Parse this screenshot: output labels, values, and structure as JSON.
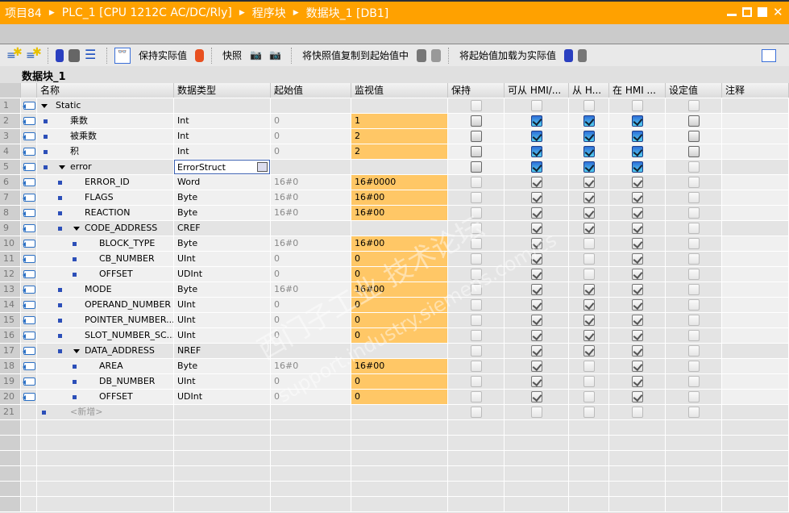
{
  "breadcrumb": [
    "项目84",
    "PLC_1 [CPU 1212C AC/DC/Rly]",
    "程序块",
    "数据块_1 [DB1]"
  ],
  "toolbar": {
    "keep_actual": "保持实际值",
    "snapshot": "快照",
    "copy_snapshot": "将快照值复制到起始值中",
    "load_start": "将起始值加载为实际值"
  },
  "block_title": "数据块_1",
  "columns": [
    "名称",
    "数据类型",
    "起始值",
    "监视值",
    "保持",
    "可从 HMI/...",
    "从 H...",
    "在 HMI ...",
    "设定值",
    "注释"
  ],
  "rows": [
    {
      "n": "1",
      "name": "Static",
      "lvl": 0,
      "exp": true,
      "type": "",
      "start": "",
      "mon": "",
      "cbs": "ddddd"
    },
    {
      "n": "2",
      "name": "乘数",
      "lvl": 1,
      "type": "Int",
      "start": "0",
      "mon": "1",
      "cbs": "ucccu"
    },
    {
      "n": "3",
      "name": "被乘数",
      "lvl": 1,
      "type": "Int",
      "start": "0",
      "mon": "2",
      "cbs": "ucccu"
    },
    {
      "n": "4",
      "name": "积",
      "lvl": 1,
      "type": "Int",
      "start": "0",
      "mon": "2",
      "cbs": "ucccu"
    },
    {
      "n": "5",
      "name": "error",
      "lvl": 1,
      "exp": true,
      "type": "ErrorStruct",
      "start": "",
      "mon": "",
      "cbs": "ucccd",
      "edit": true
    },
    {
      "n": "6",
      "name": "ERROR_ID",
      "lvl": 2,
      "type": "Word",
      "start": "16#0",
      "mon": "16#0000",
      "cbs": "dgggd"
    },
    {
      "n": "7",
      "name": "FLAGS",
      "lvl": 2,
      "type": "Byte",
      "start": "16#0",
      "mon": "16#00",
      "cbs": "dgggd"
    },
    {
      "n": "8",
      "name": "REACTION",
      "lvl": 2,
      "type": "Byte",
      "start": "16#0",
      "mon": "16#00",
      "cbs": "dgggd"
    },
    {
      "n": "9",
      "name": "CODE_ADDRESS",
      "lvl": 2,
      "exp": true,
      "type": "CREF",
      "start": "",
      "mon": "",
      "cbs": "dgggd"
    },
    {
      "n": "10",
      "name": "BLOCK_TYPE",
      "lvl": 3,
      "type": "Byte",
      "start": "16#0",
      "mon": "16#00",
      "cbs": "dgdgd"
    },
    {
      "n": "11",
      "name": "CB_NUMBER",
      "lvl": 3,
      "type": "UInt",
      "start": "0",
      "mon": "0",
      "cbs": "dgdgd"
    },
    {
      "n": "12",
      "name": "OFFSET",
      "lvl": 3,
      "type": "UDInt",
      "start": "0",
      "mon": "0",
      "cbs": "dgdgd"
    },
    {
      "n": "13",
      "name": "MODE",
      "lvl": 2,
      "type": "Byte",
      "start": "16#0",
      "mon": "16#00",
      "cbs": "dgggd"
    },
    {
      "n": "14",
      "name": "OPERAND_NUMBER",
      "lvl": 2,
      "type": "UInt",
      "start": "0",
      "mon": "0",
      "cbs": "dgggd"
    },
    {
      "n": "15",
      "name": "POINTER_NUMBER...",
      "lvl": 2,
      "type": "UInt",
      "start": "0",
      "mon": "0",
      "cbs": "dgggd"
    },
    {
      "n": "16",
      "name": "SLOT_NUMBER_SC...",
      "lvl": 2,
      "type": "UInt",
      "start": "0",
      "mon": "0",
      "cbs": "dgggd"
    },
    {
      "n": "17",
      "name": "DATA_ADDRESS",
      "lvl": 2,
      "exp": true,
      "type": "NREF",
      "start": "",
      "mon": "",
      "cbs": "dgggd"
    },
    {
      "n": "18",
      "name": "AREA",
      "lvl": 3,
      "type": "Byte",
      "start": "16#0",
      "mon": "16#00",
      "cbs": "dgdgd"
    },
    {
      "n": "19",
      "name": "DB_NUMBER",
      "lvl": 3,
      "type": "UInt",
      "start": "0",
      "mon": "0",
      "cbs": "dgdgd"
    },
    {
      "n": "20",
      "name": "OFFSET",
      "lvl": 3,
      "type": "UDInt",
      "start": "0",
      "mon": "0",
      "cbs": "dgdgd"
    },
    {
      "n": "21",
      "name": "<新增>",
      "lvl": 1,
      "add": true,
      "type": "",
      "start": "",
      "mon": "",
      "cbs": "ddddd"
    }
  ],
  "watermark": "西门子工业 技术论坛",
  "watermark_url": "support.industry.siemens.com/cs"
}
